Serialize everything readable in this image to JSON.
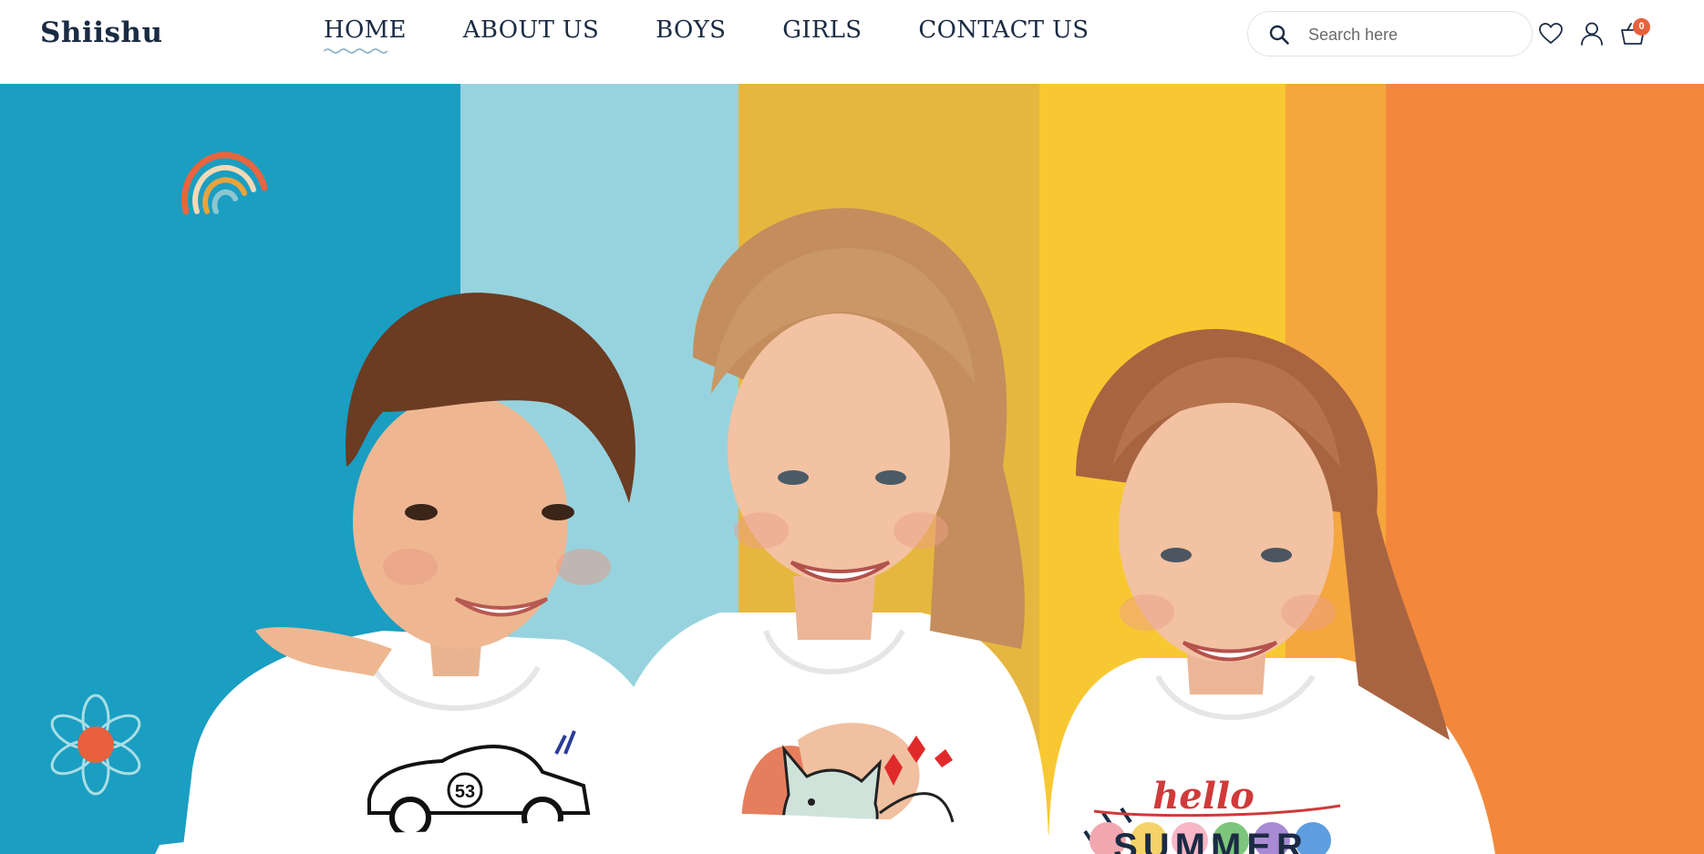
{
  "brand": {
    "logo": "Shiishu"
  },
  "nav": {
    "items": [
      {
        "label": "HOME",
        "active": true
      },
      {
        "label": "ABOUT US"
      },
      {
        "label": "BOYS"
      },
      {
        "label": "GIRLS"
      },
      {
        "label": "CONTACT US"
      }
    ]
  },
  "search": {
    "placeholder": "Search here",
    "icon": "search-icon"
  },
  "actions": {
    "wishlist_icon": "heart-icon",
    "account_icon": "user-icon",
    "cart_icon": "basket-icon",
    "cart_count": "0"
  },
  "hero": {
    "image": "three smiling children in white t-shirts against rainbow striped wall",
    "shirt_text_1": "53",
    "shirt_text_2": "hello",
    "shirt_text_3": "SUMMER",
    "colors": {
      "accent": "#e8603c",
      "navy": "#1b2b44",
      "blue": "#1a9ec2",
      "yellow": "#f8c832",
      "orange": "#f3883c"
    }
  }
}
